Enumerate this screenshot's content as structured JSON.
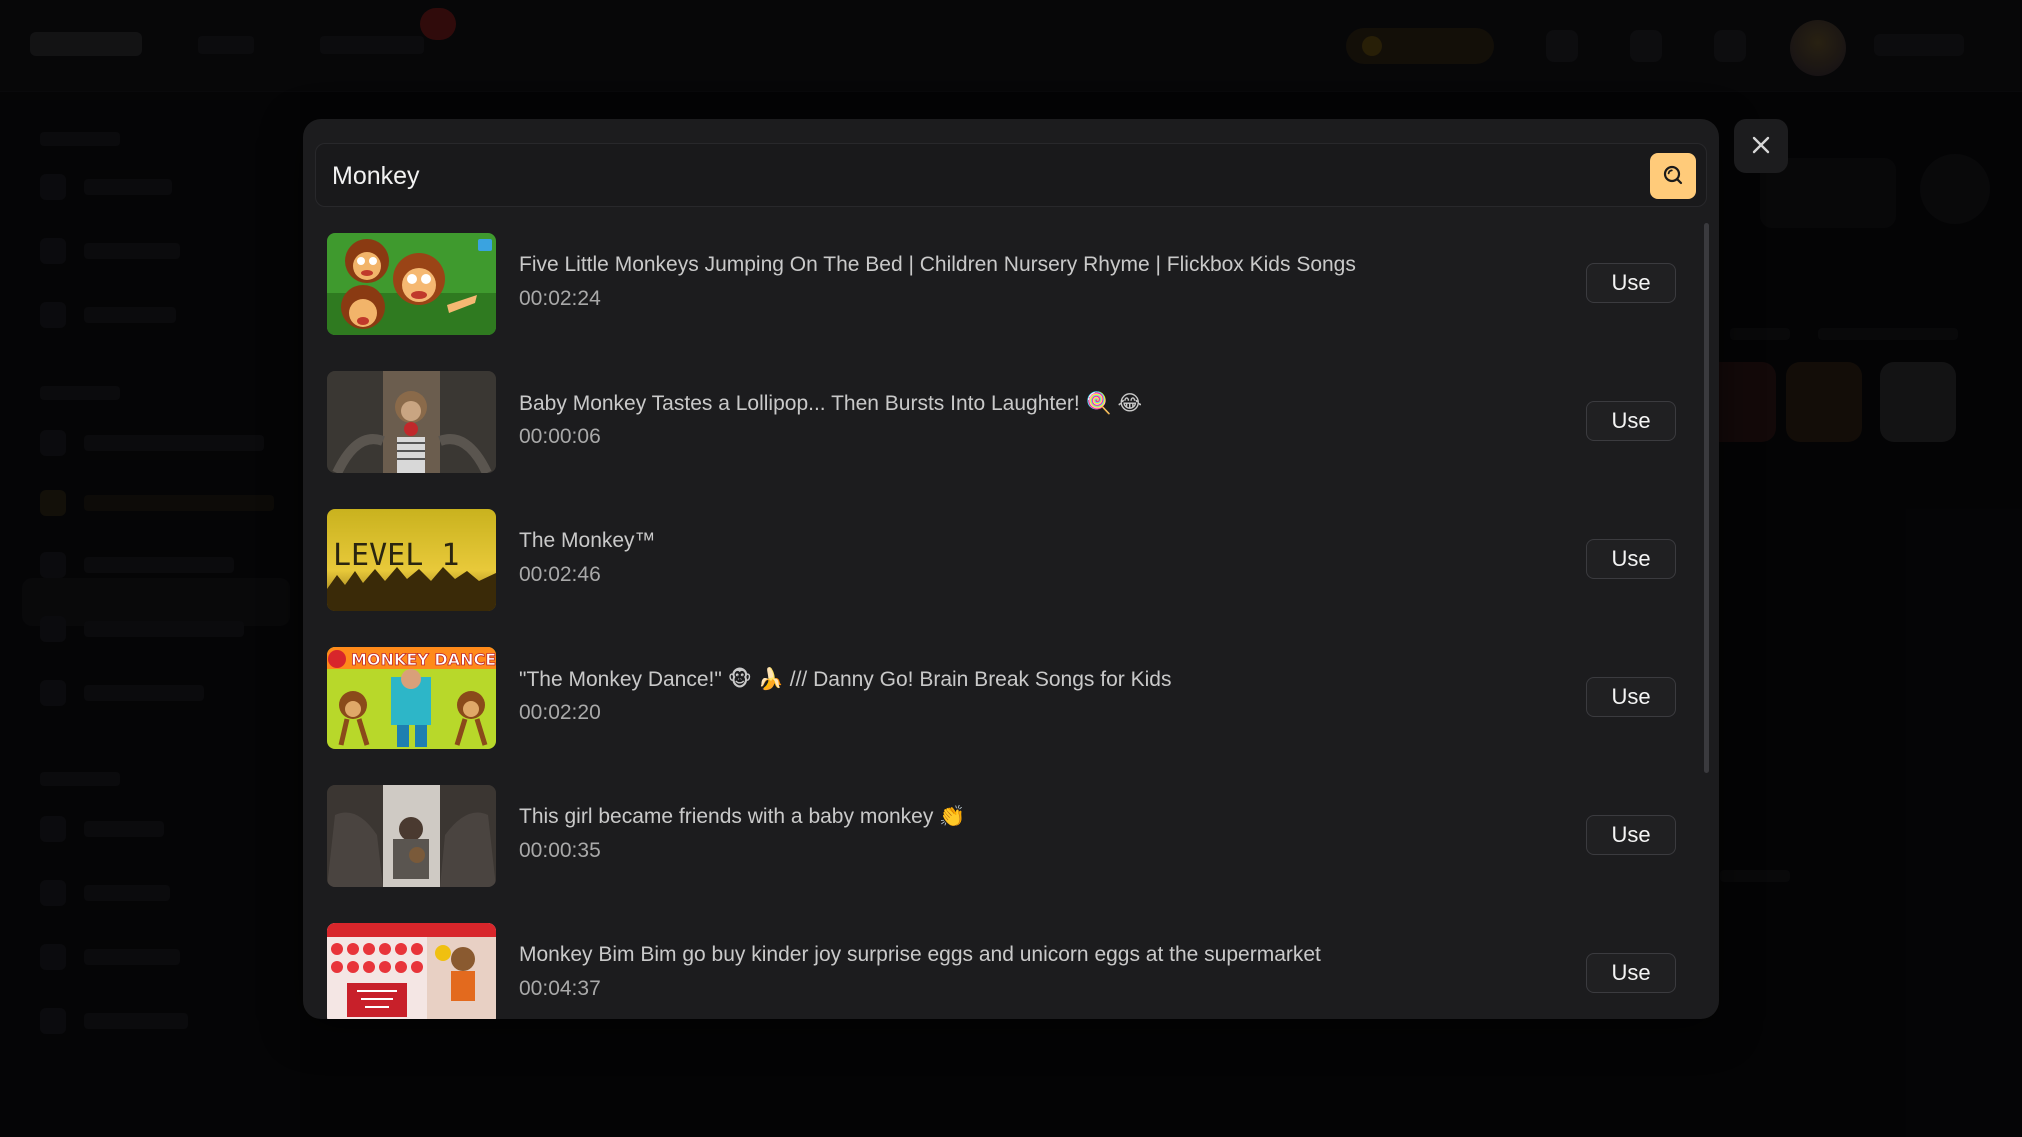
{
  "search": {
    "query": "Monkey"
  },
  "results": [
    {
      "title": "Five Little Monkeys Jumping On The Bed | Children Nursery Rhyme | Flickbox Kids Songs",
      "duration": "00:02:24",
      "action": "Use"
    },
    {
      "title": "Baby Monkey Tastes a Lollipop... Then Bursts Into Laughter! 🍭 😂",
      "duration": "00:00:06",
      "action": "Use"
    },
    {
      "title": "The Monkey™",
      "duration": "00:02:46",
      "action": "Use"
    },
    {
      "title": "\"The Monkey Dance!\" 🐵 🍌 /// Danny Go! Brain Break Songs for Kids",
      "duration": "00:02:20",
      "action": "Use"
    },
    {
      "title": "This girl became friends with a baby monkey 👏",
      "duration": "00:00:35",
      "action": "Use"
    },
    {
      "title": "Monkey Bim Bim go buy kinder joy surprise eggs and unicorn eggs at the supermarket",
      "duration": "00:04:37",
      "action": "Use"
    }
  ],
  "thumbnails": {
    "level_text": "LEVEL 1",
    "monkey_dance_text": "MONKEY DANCE!"
  },
  "colors": {
    "accent": "#ffcb7a",
    "modal_bg": "#1c1c1e",
    "overlay": "#000000"
  },
  "icons": {
    "search": "search-icon",
    "close": "close-icon"
  }
}
